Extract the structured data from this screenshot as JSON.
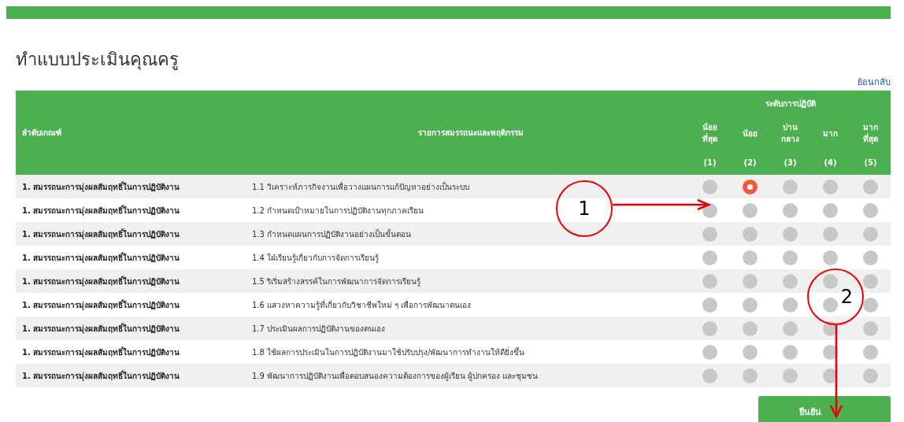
{
  "page": {
    "title": "ทำแบบประเมินคุณครู",
    "back_link": "ย้อนกลับ"
  },
  "table": {
    "columns": [
      "ลำดับเกณฑ์",
      "รายการสมรรถนะและพฤติกรรม"
    ],
    "level_group": "ระดับการปฏิบัติ",
    "levels": [
      {
        "label": "น้อย ที่สุด",
        "number": "(1)"
      },
      {
        "label": "น้อย",
        "number": "(2)"
      },
      {
        "label": "ปาน กลาง",
        "number": "(3)"
      },
      {
        "label": "มาก",
        "number": "(4)"
      },
      {
        "label": "มาก ที่สุด",
        "number": "(5)"
      }
    ],
    "rows": [
      {
        "criterion": "1. สมรรถนะการมุ่งผลสัมฤทธิ์ในการปฏิบัติงาน",
        "item": "1.1 วิเคราะห์ภารกิจงานเพื่อวางแผนการแก้ปัญหาอย่างเป็นระบบ",
        "options": [
          {
            "selected": false
          },
          {
            "selected": true
          },
          {
            "selected": false
          },
          {
            "selected": false
          },
          {
            "selected": false
          }
        ]
      },
      {
        "criterion": "1. สมรรถนะการมุ่งผลสัมฤทธิ์ในการปฏิบัติงาน",
        "item": "1.2 กำหนดเป้าหมายในการปฏิบัติงานทุกภาคเรียน",
        "options": [
          {
            "selected": false
          },
          {
            "selected": false
          },
          {
            "selected": false
          },
          {
            "selected": false
          },
          {
            "selected": false
          }
        ]
      },
      {
        "criterion": "1. สมรรถนะการมุ่งผลสัมฤทธิ์ในการปฏิบัติงาน",
        "item": "1.3 กำหนดแผนการปฏิบัติงานอย่างเป็นขั้นตอน",
        "options": [
          {
            "selected": false
          },
          {
            "selected": false
          },
          {
            "selected": false
          },
          {
            "selected": false
          },
          {
            "selected": false
          }
        ]
      },
      {
        "criterion": "1. สมรรถนะการมุ่งผลสัมฤทธิ์ในการปฏิบัติงาน",
        "item": "1.4 ใฝ่เรียนรู้เกี่ยวกับการจัดการเรียนรู้",
        "options": [
          {
            "selected": false
          },
          {
            "selected": false
          },
          {
            "selected": false
          },
          {
            "selected": false
          },
          {
            "selected": false
          }
        ]
      },
      {
        "criterion": "1. สมรรถนะการมุ่งผลสัมฤทธิ์ในการปฏิบัติงาน",
        "item": "1.5 ริเริ่มสร้างสรรค์ในการพัฒนาการจัดการเรียนรู้",
        "options": [
          {
            "selected": false
          },
          {
            "selected": false
          },
          {
            "selected": false
          },
          {
            "selected": false
          },
          {
            "selected": false
          }
        ]
      },
      {
        "criterion": "1. สมรรถนะการมุ่งผลสัมฤทธิ์ในการปฏิบัติงาน",
        "item": "1.6 แสวงหาความรู้ที่เกี่ยวกับวิชาชีพใหม่ ๆ เพื่อการพัฒนาตนเอง",
        "options": [
          {
            "selected": false
          },
          {
            "selected": false
          },
          {
            "selected": false
          },
          {
            "selected": false
          },
          {
            "selected": false
          }
        ]
      },
      {
        "criterion": "1. สมรรถนะการมุ่งผลสัมฤทธิ์ในการปฏิบัติงาน",
        "item": "1.7 ประเมินผลการปฏิบัติงานของตนเอง",
        "options": [
          {
            "selected": false
          },
          {
            "selected": false
          },
          {
            "selected": false
          },
          {
            "selected": false
          },
          {
            "selected": false
          }
        ]
      },
      {
        "criterion": "1. สมรรถนะการมุ่งผลสัมฤทธิ์ในการปฏิบัติงาน",
        "item": "1.8 ใช้ผลการประเมินในการปฏิบัติงานมาใช้ปรับปรุง/พัฒนาการทำงานให้ดียิ่งขึ้น",
        "options": [
          {
            "selected": false
          },
          {
            "selected": false
          },
          {
            "selected": false
          },
          {
            "selected": false
          },
          {
            "selected": false
          }
        ]
      },
      {
        "criterion": "1. สมรรถนะการมุ่งผลสัมฤทธิ์ในการปฏิบัติงาน",
        "item": "1.9 พัฒนาการปฏิบัติงานเพื่อตอบสนองความต้องการของผู้เรียน ผู้ปกครอง และชุมชน",
        "options": [
          {
            "selected": false
          },
          {
            "selected": false
          },
          {
            "selected": false
          },
          {
            "selected": false
          },
          {
            "selected": false
          }
        ]
      }
    ]
  },
  "submit_button": "ยืนยัน",
  "callouts": [
    {
      "number": "1"
    },
    {
      "number": "2"
    }
  ]
}
